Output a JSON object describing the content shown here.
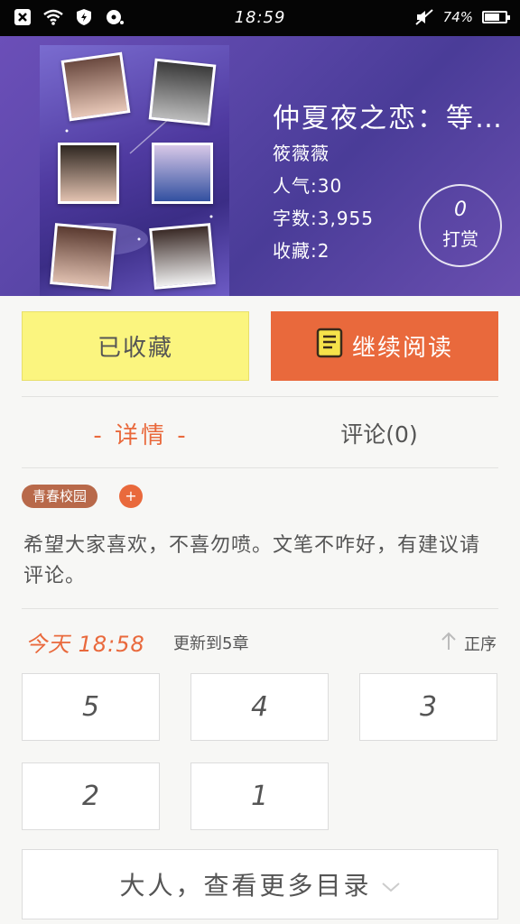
{
  "status_bar": {
    "time": "18:59",
    "battery": "74%",
    "battery_level": 0.74
  },
  "book": {
    "title": "仲夏夜之恋：等…",
    "author": "筱薇薇",
    "popularity": "人气:30",
    "word_count": "字数:3,955",
    "favorites": "收藏:2",
    "tip_count": "0",
    "tip_label": "打赏"
  },
  "actions": {
    "favorited_label": "已收藏",
    "continue_label": "继续阅读"
  },
  "tabs": {
    "detail": "- 详情 -",
    "comments": "评论(0)"
  },
  "tags": [
    "青春校园"
  ],
  "tag_add": "+",
  "description": "希望大家喜欢，不喜勿喷。文笔不咋好，有建议请评论。",
  "update": {
    "time": "今天 18:58",
    "text": "更新到5章",
    "sort_label": "正序"
  },
  "chapters": [
    "5",
    "4",
    "3",
    "2",
    "1"
  ],
  "more_label": "大人，查看更多目录",
  "colors": {
    "accent": "#e9693c",
    "favorite_bg": "#fbf57f",
    "header_bg": "#5a46a8"
  }
}
